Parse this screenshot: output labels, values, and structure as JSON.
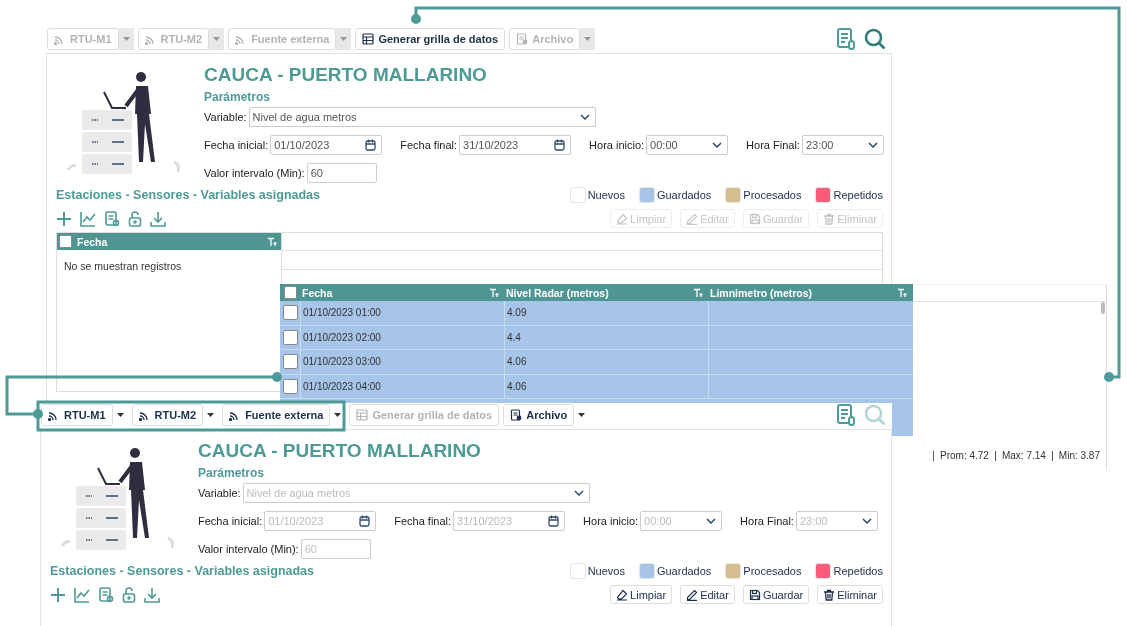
{
  "screens": [
    {
      "toolbar": [
        {
          "label": "RTU-M1",
          "kind": "dropdown",
          "disabled": true
        },
        {
          "label": "RTU-M2",
          "kind": "dropdown",
          "disabled": true
        },
        {
          "label": "Fuente externa",
          "kind": "dropdown",
          "disabled": true
        },
        {
          "label": "Generar grilla de datos",
          "kind": "button",
          "disabled": false
        },
        {
          "label": "Archivo",
          "kind": "dropdown",
          "disabled": true
        }
      ],
      "search_disabled": false,
      "title": "CAUCA - PUERTO MALLARINO",
      "section": "Parámetros",
      "fields_disabled": false,
      "field_rows": [
        [
          {
            "label": "Variable:",
            "value": "Nivel de agua metros",
            "kind": "select"
          }
        ],
        [
          {
            "label": "Fecha inicial:",
            "value": "01/10/2023",
            "kind": "date"
          },
          {
            "label": "Fecha final:",
            "value": "31/10/2023",
            "kind": "date"
          },
          {
            "label": "Hora inicio:",
            "value": "00:00",
            "kind": "time"
          },
          {
            "label": "Hora Final:",
            "value": "23:00",
            "kind": "time"
          }
        ],
        [
          {
            "label": "Valor intervalo (Min):",
            "value": "60",
            "kind": "number"
          }
        ]
      ],
      "subtitle": "Estaciones - Sensores - Variables asignadas",
      "legend": [
        {
          "label": "Nuevos",
          "color": "#ffffff"
        },
        {
          "label": "Guardados",
          "color": "#a6c5e8"
        },
        {
          "label": "Procesados",
          "color": "#d6bd90"
        },
        {
          "label": "Repetidos",
          "color": "#fb5c7a"
        }
      ],
      "actions": [
        {
          "label": "Limpiar",
          "disabled": true
        },
        {
          "label": "Editar",
          "disabled": true
        },
        {
          "label": "Guardar",
          "disabled": true
        },
        {
          "label": "Eliminar",
          "disabled": true
        }
      ],
      "grid": {
        "column": "Fecha",
        "all_checked": false,
        "empty": "No se muestran registros"
      }
    },
    {
      "toolbar": [
        {
          "label": "RTU-M1",
          "kind": "dropdown",
          "disabled": false
        },
        {
          "label": "RTU-M2",
          "kind": "dropdown",
          "disabled": false
        },
        {
          "label": "Fuente externa",
          "kind": "dropdown",
          "disabled": false
        },
        {
          "label": "Generar grilla de datos",
          "kind": "button",
          "disabled": true
        },
        {
          "label": "Archivo",
          "kind": "dropdown",
          "disabled": false
        }
      ],
      "search_disabled": true,
      "title": "CAUCA - PUERTO MALLARINO",
      "section": "Parámetros",
      "fields_disabled": true,
      "field_rows": [
        [
          {
            "label": "Variable:",
            "value": "Nivel de agua metros",
            "kind": "select"
          }
        ],
        [
          {
            "label": "Fecha inicial:",
            "value": "01/10/2023",
            "kind": "date"
          },
          {
            "label": "Fecha final:",
            "value": "31/10/2023",
            "kind": "date"
          },
          {
            "label": "Hora inicio:",
            "value": "00:00",
            "kind": "time"
          },
          {
            "label": "Hora Final:",
            "value": "23:00",
            "kind": "time"
          }
        ],
        [
          {
            "label": "Valor intervalo (Min):",
            "value": "60",
            "kind": "number"
          }
        ]
      ],
      "subtitle": "Estaciones - Sensores - Variables asignadas",
      "legend": [
        {
          "label": "Nuevos",
          "color": "#ffffff"
        },
        {
          "label": "Guardados",
          "color": "#a6c5e8"
        },
        {
          "label": "Procesados",
          "color": "#d6bd90"
        },
        {
          "label": "Repetidos",
          "color": "#fb5c7a"
        }
      ],
      "actions": [
        {
          "label": "Limpiar",
          "disabled": false
        },
        {
          "label": "Editar",
          "disabled": false
        },
        {
          "label": "Guardar",
          "disabled": false
        },
        {
          "label": "Eliminar",
          "disabled": false
        }
      ]
    }
  ],
  "data_table": {
    "all_checked": false,
    "columns": [
      "Fecha",
      "Nivel Radar (metros)",
      "Limnimetro (metros)"
    ],
    "rows": [
      {
        "cells": [
          "01/10/2023 01:00",
          "4.09",
          ""
        ],
        "checked": false
      },
      {
        "cells": [
          "01/10/2023 02:00",
          "4.4",
          ""
        ],
        "checked": false
      },
      {
        "cells": [
          "01/10/2023 03:00",
          "4.06",
          ""
        ],
        "checked": false
      },
      {
        "cells": [
          "01/10/2023 04:00",
          "4.06",
          ""
        ],
        "checked": false
      }
    ],
    "stats": [
      "Prom: 4.72",
      "Max: 7.14",
      "Min: 3.87"
    ]
  }
}
